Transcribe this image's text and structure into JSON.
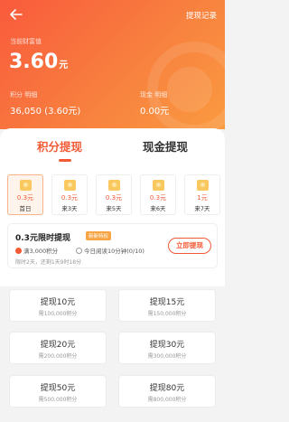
{
  "header": {
    "history_label": "提现记录",
    "wealth_label": "当前财富值",
    "wealth_amount": "3.60",
    "wealth_unit": "元",
    "points_label": "积分 明细",
    "points_value": "36,050 (3.60元)",
    "cash_label": "现金 明细",
    "cash_value": "0.00元"
  },
  "tabs": [
    {
      "label": "积分提现"
    },
    {
      "label": "现金提现"
    }
  ],
  "days": [
    {
      "amount": "0.3元",
      "label": "首日"
    },
    {
      "amount": "0.3元",
      "label": "来3天"
    },
    {
      "amount": "0.3元",
      "label": "来5天"
    },
    {
      "amount": "0.3元",
      "label": "来6天"
    },
    {
      "amount": "1元",
      "label": "来7天"
    }
  ],
  "limited": {
    "title": "0.3元限时提现",
    "badge": "新新特权",
    "req1": "满3,000积分",
    "req2": "今日阅读10分钟(0/10)",
    "tip": "限时2天，还剩1天9时18分",
    "button": "立即提现"
  },
  "options": [
    {
      "title": "提现10元",
      "sub": "需100,000积分"
    },
    {
      "title": "提现15元",
      "sub": "需150,000积分"
    },
    {
      "title": "提现20元",
      "sub": "需200,000积分"
    },
    {
      "title": "提现30元",
      "sub": "需300,000积分"
    },
    {
      "title": "提现50元",
      "sub": "需500,000积分"
    },
    {
      "title": "提现80元",
      "sub": "需800,000积分"
    }
  ]
}
